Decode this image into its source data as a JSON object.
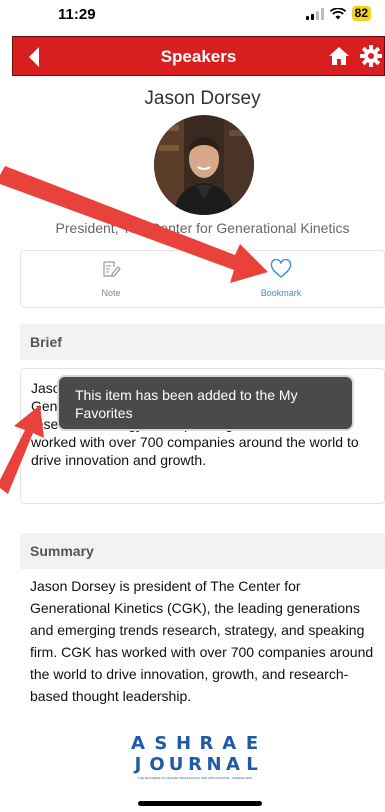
{
  "status_bar": {
    "time": "11:29",
    "battery": "82"
  },
  "header": {
    "title": "Speakers"
  },
  "speaker": {
    "name": "Jason Dorsey",
    "title": "President, The Center for Generational Kinetics"
  },
  "actions": [
    {
      "label": "Note",
      "icon": "note-edit-icon"
    },
    {
      "label": "Bookmark",
      "icon": "heart-icon"
    }
  ],
  "brief": {
    "heading": "Brief",
    "text": "Jason Dorsey is president of The Center for Generational Kinetics, the leading generations research, strategy, and speaking firm, which has worked with over 700 companies around the world to drive innovation and growth."
  },
  "toast": {
    "message": "This item has been added to the My Favorites"
  },
  "summary": {
    "heading": "Summary",
    "text": "Jason Dorsey is president of The Center for Generational Kinetics (CGK), the leading generations and emerging trends research, strategy, and speaking firm. CGK has worked with over 700 companies around the world to drive innovation, growth, and research-based thought leadership."
  },
  "logo": {
    "line1": "ASHRAE",
    "line2": "JOURNAL",
    "tagline": "THE MAGAZINE OF HVAC&R TECHNOLOGY AND APPLICATIONS · ASHRAE.ORG"
  },
  "colors": {
    "header": "#d81e1e",
    "accent": "#3a8fd0",
    "annotation_arrow": "#e8423a",
    "logo": "#1f5aa6"
  }
}
